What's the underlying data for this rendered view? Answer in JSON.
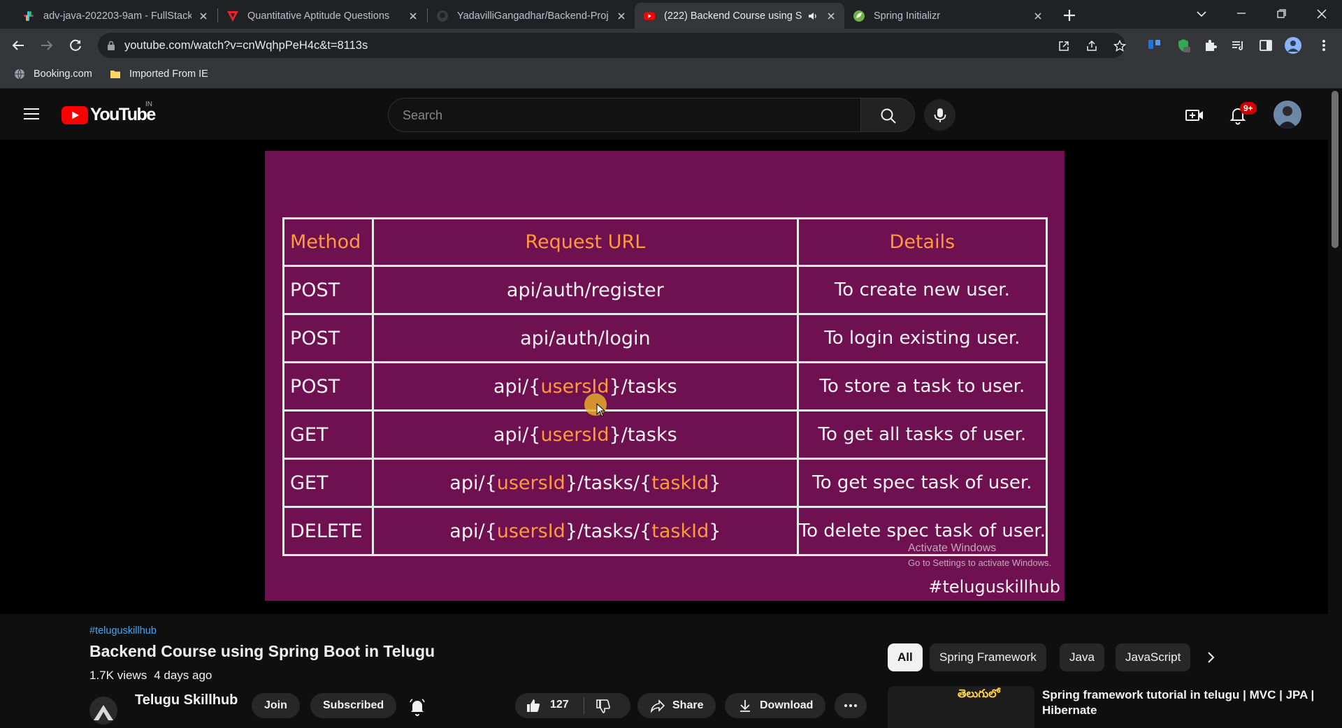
{
  "browser": {
    "tabs": [
      {
        "title": "adv-java-202203-9am - FullStack",
        "favicon": "slack-icon",
        "active": false
      },
      {
        "title": "Quantitative Aptitude Questions",
        "favicon": "testbook-icon",
        "active": false
      },
      {
        "title": "YadavilliGangadhar/Backend-Proj",
        "favicon": "github-icon",
        "active": false
      },
      {
        "title": "(222) Backend Course using S",
        "favicon": "youtube-icon",
        "active": true,
        "audio": true
      },
      {
        "title": "Spring Initializr",
        "favicon": "spring-icon",
        "active": false
      }
    ],
    "url": "youtube.com/watch?v=cnWqhpPeH4c&t=8113s",
    "bookmarks": [
      {
        "label": "Booking.com",
        "icon": "globe-icon"
      },
      {
        "label": "Imported From IE",
        "icon": "folder-icon"
      }
    ]
  },
  "youtube": {
    "logo_text": "YouTube",
    "country": "IN",
    "search_placeholder": "Search",
    "notifications_badge": "9+"
  },
  "video_slide": {
    "headers": [
      "Method",
      "Request URL",
      "Details"
    ],
    "rows": [
      {
        "method": "POST",
        "url": [
          {
            "t": "api/auth/register"
          }
        ],
        "details": "To create new user."
      },
      {
        "method": "POST",
        "url": [
          {
            "t": "api/auth/login"
          }
        ],
        "details": "To login existing user."
      },
      {
        "method": "POST",
        "url": [
          {
            "t": "api/{"
          },
          {
            "t": "usersId",
            "p": true
          },
          {
            "t": "}/tasks"
          }
        ],
        "details": "To store a task to user."
      },
      {
        "method": "GET",
        "url": [
          {
            "t": "api/{"
          },
          {
            "t": "usersId",
            "p": true
          },
          {
            "t": "}/tasks"
          }
        ],
        "details": "To get all tasks of user."
      },
      {
        "method": "GET",
        "url": [
          {
            "t": "api/{"
          },
          {
            "t": "usersId",
            "p": true
          },
          {
            "t": "}/tasks/{"
          },
          {
            "t": "taskId",
            "p": true
          },
          {
            "t": "}"
          }
        ],
        "details": "To get spec task of user."
      },
      {
        "method": "DELETE",
        "url": [
          {
            "t": "api/{"
          },
          {
            "t": "usersId",
            "p": true
          },
          {
            "t": "}/tasks/{"
          },
          {
            "t": "taskId",
            "p": true
          },
          {
            "t": "}"
          }
        ],
        "details": "To delete spec task of user."
      }
    ],
    "watermark_line1": "Activate Windows",
    "watermark_line2": "Go to Settings to activate Windows.",
    "hashtag": "#teluguskillhub"
  },
  "video_info": {
    "hashtag": "#teluguskillhub",
    "title": "Backend Course using Spring Boot in Telugu",
    "views": "1.7K views",
    "age": "4 days ago",
    "channel": "Telugu Skillhub",
    "join_label": "Join",
    "subscribed_label": "Subscribed",
    "like_count": "127",
    "share_label": "Share",
    "download_label": "Download"
  },
  "sidebar": {
    "chips": [
      "All",
      "Spring Framework",
      "Java",
      "JavaScript"
    ],
    "selected_chip": "All",
    "recommendation": {
      "thumb_text": "తెలుగులో",
      "title": "Spring framework tutorial in telugu | MVC | JPA | Hibernate"
    }
  },
  "colors": {
    "accent": "#ff9a3c",
    "slide_bg": "#6f1050",
    "yt_red": "#ff0000",
    "link": "#3ea6ff"
  }
}
